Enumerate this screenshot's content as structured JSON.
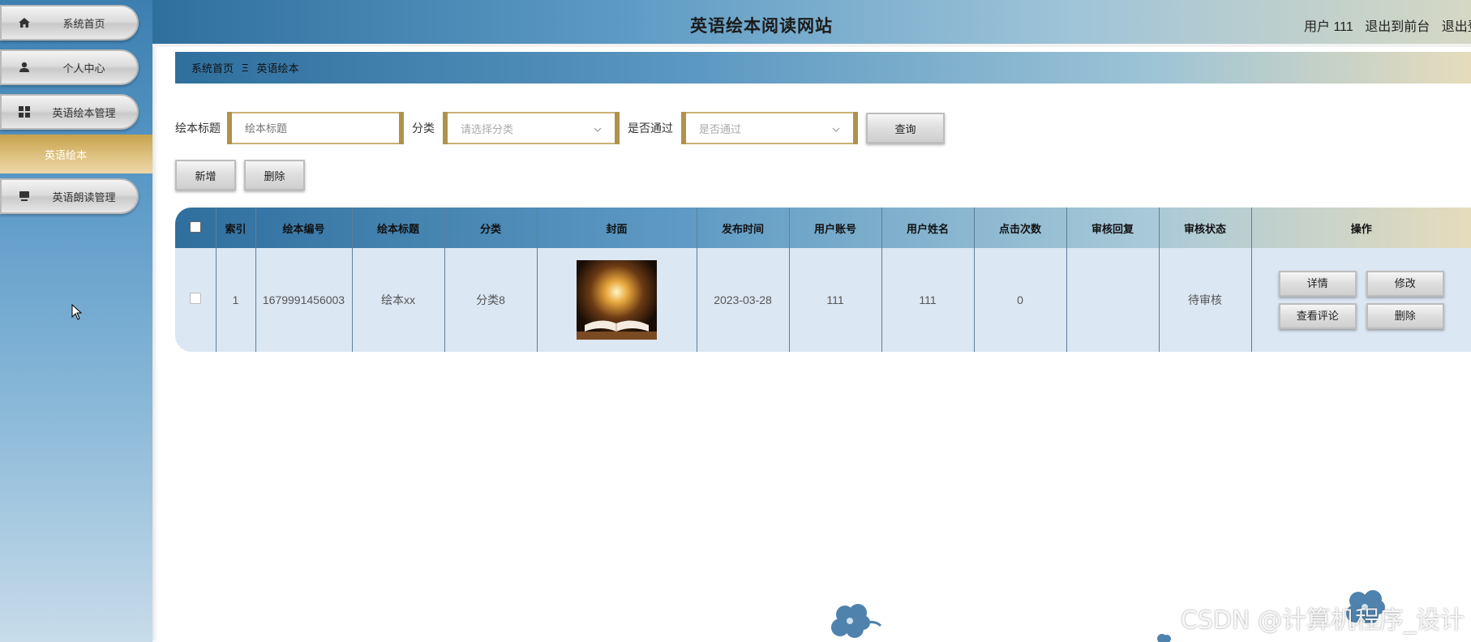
{
  "sidebar": {
    "items": [
      {
        "label": "系统首页",
        "icon": "home-icon"
      },
      {
        "label": "个人中心",
        "icon": "user-icon"
      },
      {
        "label": "英语绘本管理",
        "icon": "grid-icon"
      },
      {
        "label": "英语朗读管理",
        "icon": "monitor-icon"
      }
    ],
    "active_sub": "英语绘本"
  },
  "header": {
    "title": "英语绘本阅读网站",
    "user": "用户 111",
    "back_to_front": "退出到前台",
    "logout": "退出登"
  },
  "breadcrumb": {
    "home": "系统首页",
    "separator": "Ξ",
    "current": "英语绘本"
  },
  "search": {
    "title_label": "绘本标题",
    "title_placeholder": "绘本标题",
    "category_label": "分类",
    "category_placeholder": "请选择分类",
    "approved_label": "是否通过",
    "approved_placeholder": "是否通过",
    "query_button": "查询"
  },
  "actions": {
    "add": "新增",
    "delete": "删除"
  },
  "table": {
    "columns": [
      "索引",
      "绘本编号",
      "绘本标题",
      "分类",
      "封面",
      "发布时间",
      "用户账号",
      "用户姓名",
      "点击次数",
      "审核回复",
      "审核状态",
      "操作"
    ],
    "rows": [
      {
        "index": "1",
        "book_no": "1679991456003",
        "title": "绘本xx",
        "category": "分类8",
        "publish_time": "2023-03-28",
        "user_account": "111",
        "user_name": "111",
        "clicks": "0",
        "review_reply": "",
        "review_status": "待审核",
        "ops": {
          "detail": "详情",
          "edit": "修改",
          "comments": "查看评论",
          "delete": "删除"
        }
      }
    ]
  },
  "watermark": "CSDN @计算机程序_设计",
  "colors": {
    "accent_gold": "#b0924e",
    "header_blue": "#2f6f9e",
    "row_bg": "#dbe7f3"
  }
}
